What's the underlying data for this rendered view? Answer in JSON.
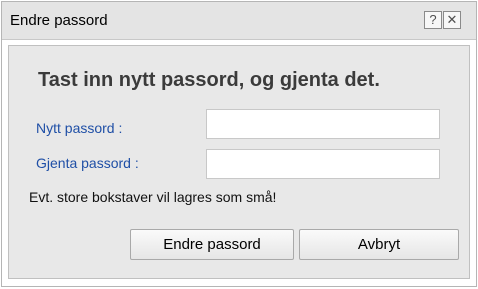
{
  "dialog": {
    "title": "Endre passord",
    "help_glyph": "?",
    "close_glyph": "✕",
    "heading": "Tast inn nytt passord, og gjenta det.",
    "new_password_label": "Nytt passord :",
    "new_password_value": "",
    "repeat_password_label": "Gjenta passord :",
    "repeat_password_value": "",
    "note": "Evt. store bokstaver vil lagres som små!",
    "change_button_label": "Endre passord",
    "cancel_button_label": "Avbryt"
  }
}
